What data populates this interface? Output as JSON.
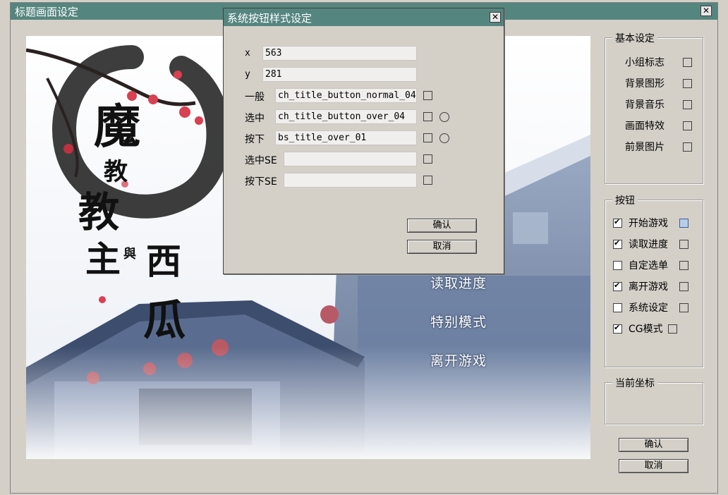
{
  "main_window": {
    "title": "标题画面设定",
    "close_glyph": "✕"
  },
  "preview": {
    "menu_items": [
      "读取进度",
      "特别模式",
      "离开游戏"
    ],
    "logo_text": "魔教教主與西瓜"
  },
  "basic_settings": {
    "label": "基本设定",
    "items": [
      {
        "label": "小组标志"
      },
      {
        "label": "背景图形"
      },
      {
        "label": "背景音乐"
      },
      {
        "label": "画面特效"
      },
      {
        "label": "前景图片"
      }
    ]
  },
  "buttons_group": {
    "label": "按钮",
    "items": [
      {
        "label": "开始游戏",
        "checked": true,
        "selected": true
      },
      {
        "label": "读取进度",
        "checked": true,
        "selected": false
      },
      {
        "label": "自定选单",
        "checked": false,
        "selected": false
      },
      {
        "label": "离开游戏",
        "checked": true,
        "selected": false
      },
      {
        "label": "系统设定",
        "checked": false,
        "selected": false
      },
      {
        "label": "CG模式",
        "checked": true,
        "selected": false
      }
    ]
  },
  "current_coords": {
    "label": "当前坐标"
  },
  "main_buttons": {
    "ok": "确认",
    "cancel": "取消"
  },
  "dialog": {
    "title": "系统按钮样式设定",
    "close_glyph": "✕",
    "x_label": "x",
    "x_value": "563",
    "y_label": "y",
    "y_value": "281",
    "normal_label": "一般",
    "normal_value": "ch_title_button_normal_04",
    "over_label": "选中",
    "over_value": "ch_title_button_over_04",
    "down_label": "按下",
    "down_value": "bs_title_over_01",
    "over_se_label": "选中SE",
    "over_se_value": "",
    "down_se_label": "按下SE",
    "down_se_value": "",
    "ok": "确认",
    "cancel": "取消"
  },
  "colors": {
    "titlebar": "#55857f",
    "window_bg": "#d4d0c8"
  }
}
